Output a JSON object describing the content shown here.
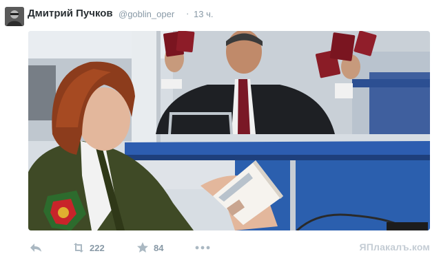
{
  "tweet": {
    "author": {
      "display_name": "Дмитрий Пучков",
      "handle": "@goblin_oper",
      "separator": "·",
      "time": "13 ч."
    },
    "media": {
      "type": "photo",
      "description_icon": "photo"
    },
    "actions": {
      "reply_icon": "reply-icon",
      "retweet_icon": "retweet-icon",
      "retweet_count": "222",
      "favorite_icon": "star-icon",
      "favorite_count": "84",
      "more_icon": "more-icon"
    },
    "watermark": "ЯПлакалъ.ком"
  },
  "colors": {
    "name": "#292f33",
    "meta": "#8899a6",
    "uniform": "#3f4a26",
    "counter_blue": "#2b5fae"
  }
}
